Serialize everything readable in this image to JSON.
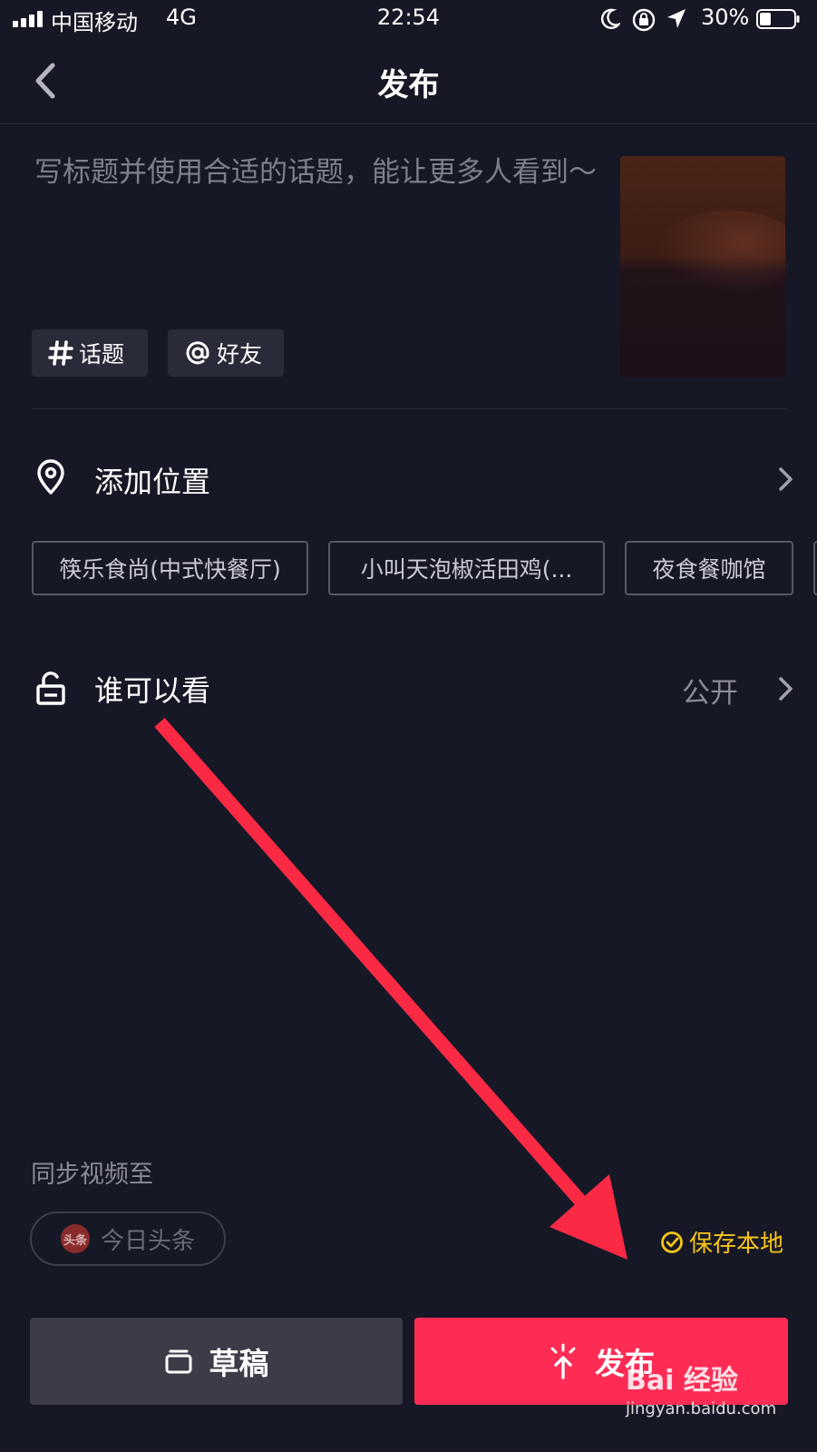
{
  "status_bar": {
    "carrier": "中国移动",
    "network": "4G",
    "time": "22:54",
    "battery_percent": "30%",
    "icons": [
      "signal-icon",
      "moon-icon",
      "rotation-lock-icon",
      "location-arrow-icon",
      "battery-icon"
    ]
  },
  "nav": {
    "title": "发布",
    "back_icon": "chevron-left-icon"
  },
  "caption": {
    "placeholder": "写标题并使用合适的话题，能让更多人看到～"
  },
  "chips": {
    "topic": "话题",
    "friend": "好友",
    "topic_icon": "hash-icon",
    "friend_icon": "at-icon"
  },
  "location": {
    "label": "添加位置",
    "icon": "location-pin-icon",
    "suggestions": [
      "筷乐食尚(中式快餐厅)",
      "小叫天泡椒活田鸡(...",
      "夜食餐咖馆"
    ]
  },
  "privacy": {
    "label": "谁可以看",
    "value": "公开",
    "icon": "unlock-icon"
  },
  "sync": {
    "label": "同步视频至",
    "target": "今日头条",
    "logo_text": "头条"
  },
  "save_local": {
    "label": "保存本地",
    "checked": true,
    "color": "#f5c518"
  },
  "buttons": {
    "draft": "草稿",
    "publish": "发布",
    "publish_color": "#fe2c55"
  },
  "watermark": {
    "brand": "Bai 经验",
    "url": "jingyan.baidu.com"
  }
}
